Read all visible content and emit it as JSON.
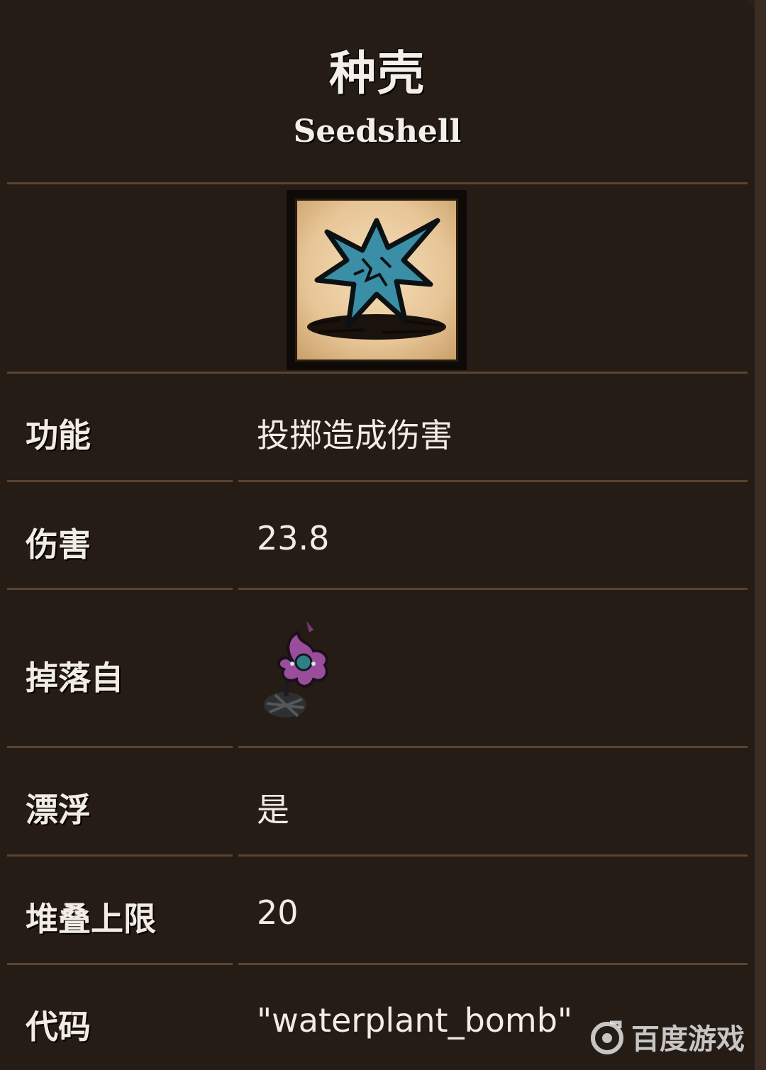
{
  "item": {
    "title": "种壳",
    "subtitle": "Seedshell",
    "icon": "seedshell-icon"
  },
  "rows": [
    {
      "label": "功能",
      "value": "投掷造成伤害"
    },
    {
      "label": "伤害",
      "value": "23.8"
    },
    {
      "label": "掉落自",
      "icon": "water-plant-icon"
    },
    {
      "label": "漂浮",
      "value": "是"
    },
    {
      "label": "堆叠上限",
      "value": "20"
    },
    {
      "label": "代码",
      "value": "\"waterplant_bomb\""
    }
  ],
  "watermark": {
    "text": "百度游戏",
    "icon": "baidu-game-logo-icon"
  },
  "colors": {
    "background": "#261c16",
    "divider": "#5a4430",
    "text": "#f2ece4",
    "seedshell_blue": "#3a8fa6",
    "flower_purple": "#9a4d9a"
  }
}
